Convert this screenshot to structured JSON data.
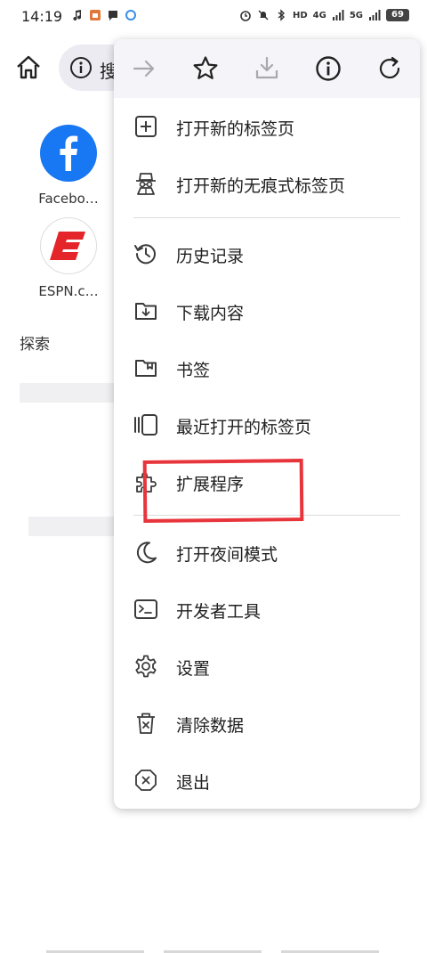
{
  "status_bar": {
    "time": "14:19",
    "network_hd": "HD",
    "network_4g": "4G",
    "network_5g": "5G",
    "battery": "69"
  },
  "background": {
    "url_text": "搜",
    "shortcuts": [
      {
        "label": "Facebo…",
        "icon": "facebook-logo"
      },
      {
        "label": "ESPN.c…",
        "icon": "espn-logo"
      }
    ],
    "explore_label": "探索"
  },
  "menu": {
    "toolbar": [
      {
        "icon": "forward-arrow-icon",
        "enabled": false
      },
      {
        "icon": "star-icon",
        "enabled": true
      },
      {
        "icon": "download-icon",
        "enabled": false
      },
      {
        "icon": "info-icon",
        "enabled": true
      },
      {
        "icon": "reload-icon",
        "enabled": true
      }
    ],
    "items": [
      {
        "label": "打开新的标签页",
        "icon": "new-tab-icon"
      },
      {
        "label": "打开新的无痕式标签页",
        "icon": "incognito-icon"
      },
      {
        "label": "历史记录",
        "icon": "history-icon"
      },
      {
        "label": "下载内容",
        "icon": "downloads-icon"
      },
      {
        "label": "书签",
        "icon": "bookmarks-icon"
      },
      {
        "label": "最近打开的标签页",
        "icon": "recent-tabs-icon"
      },
      {
        "label": "扩展程序",
        "icon": "extensions-icon"
      },
      {
        "label": "打开夜间模式",
        "icon": "night-mode-icon"
      },
      {
        "label": "开发者工具",
        "icon": "developer-tools-icon"
      },
      {
        "label": "设置",
        "icon": "settings-icon"
      },
      {
        "label": "清除数据",
        "icon": "clear-data-icon"
      },
      {
        "label": "退出",
        "icon": "exit-icon"
      }
    ]
  },
  "colors": {
    "highlight": "#e8353c",
    "facebook": "#1877f2",
    "espn": "#e4262a",
    "icon": "#3a3a3a",
    "disabled_icon": "#a8a8ad"
  }
}
